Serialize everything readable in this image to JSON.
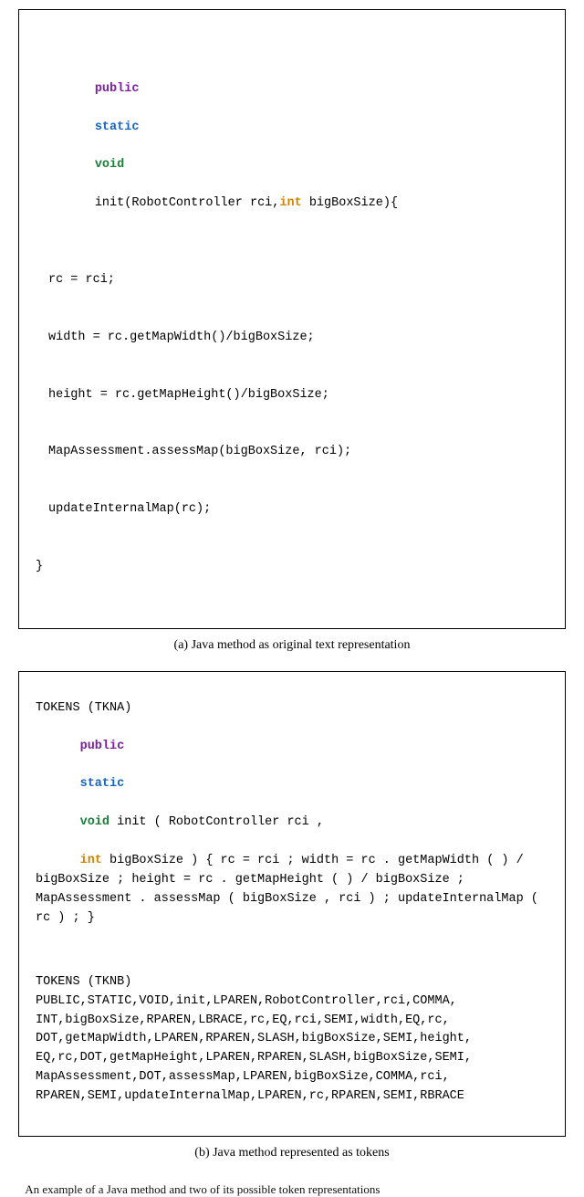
{
  "figA": {
    "caption": "(a) Java method as original text representation",
    "code": {
      "kw_public": "public",
      "kw_static": "static",
      "kw_void": "void",
      "fn": "init",
      "argtype1": "RobotController",
      "arg1": "rci",
      "kw_int": "int",
      "arg2": "bigBoxSize",
      "open": "(",
      "close": ")",
      "brace_open": "{",
      "brace_close": "}",
      "line1": "rc = rci;",
      "line2": "width = rc.getMapWidth()/bigBoxSize;",
      "line3": "height = rc.getMapHeight()/bigBoxSize;",
      "line4": "MapAssessment.assessMap(bigBoxSize, rci);",
      "line5": "updateInternalMap(rc);"
    }
  },
  "figB": {
    "caption": "(b) Java method represented as tokens",
    "tkna_label": "TOKENS (TKNA)",
    "tkna": {
      "kw_public": "public",
      "kw_static": "static",
      "kw_void": "void",
      "seg1": " init ( RobotController rci ,",
      "kw_int": "int",
      "seg2": " bigBoxSize ) { rc = rci ; width = rc . getMapWidth ( ) / bigBoxSize ; height = rc . getMapHeight ( ) / bigBoxSize ; MapAssessment . assessMap ( bigBoxSize , rci ) ; updateInternalMap ( rc ) ; }"
    },
    "tknb_label": "TOKENS (TKNB)",
    "tknb": "PUBLIC,STATIC,VOID,init,LPAREN,RobotController,rci,COMMA, INT,bigBoxSize,RPAREN,LBRACE,rc,EQ,rci,SEMI,width,EQ,rc, DOT,getMapWidth,LPAREN,RPAREN,SLASH,bigBoxSize,SEMI,height, EQ,rc,DOT,getMapHeight,LPAREN,RPAREN,SLASH,bigBoxSize,SEMI, MapAssessment,DOT,assessMap,LPAREN,bigBoxSize,COMMA,rci, RPAREN,SEMI,updateInternalMap,LPAREN,rc,RPAREN,SEMI,RBRACE"
  },
  "bottom_cut": "An example of a Java method and two of its possible token representations"
}
